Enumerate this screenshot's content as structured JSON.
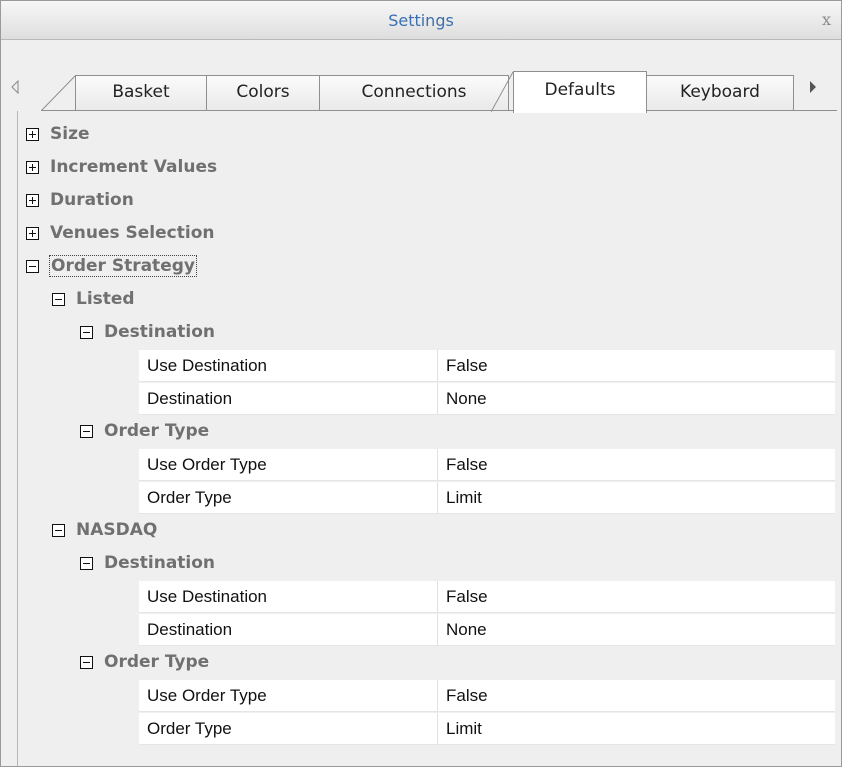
{
  "window": {
    "title": "Settings",
    "close_label": "x"
  },
  "tabs": [
    "Basket",
    "Colors",
    "Connections",
    "Defaults",
    "Keyboard"
  ],
  "active_tab": "Defaults",
  "tree": {
    "categories": [
      "Size",
      "Increment Values",
      "Duration",
      "Venues Selection",
      "Order Strategy"
    ],
    "listed": {
      "label": "Listed",
      "destination": {
        "label": "Destination",
        "rows": [
          {
            "name": "Use Destination",
            "value": "False"
          },
          {
            "name": "Destination",
            "value": "None"
          }
        ]
      },
      "order_type": {
        "label": "Order Type",
        "rows": [
          {
            "name": "Use Order Type",
            "value": "False"
          },
          {
            "name": "Order Type",
            "value": "Limit"
          }
        ]
      }
    },
    "nasdaq": {
      "label": "NASDAQ",
      "destination": {
        "label": "Destination",
        "rows": [
          {
            "name": "Use Destination",
            "value": "False"
          },
          {
            "name": "Destination",
            "value": "None"
          }
        ]
      },
      "order_type": {
        "label": "Order Type",
        "rows": [
          {
            "name": "Use Order Type",
            "value": "False"
          },
          {
            "name": "Order Type",
            "value": "Limit"
          }
        ]
      }
    }
  },
  "colors": {
    "title_text": "#3b6fb0",
    "category_text": "#707070"
  }
}
